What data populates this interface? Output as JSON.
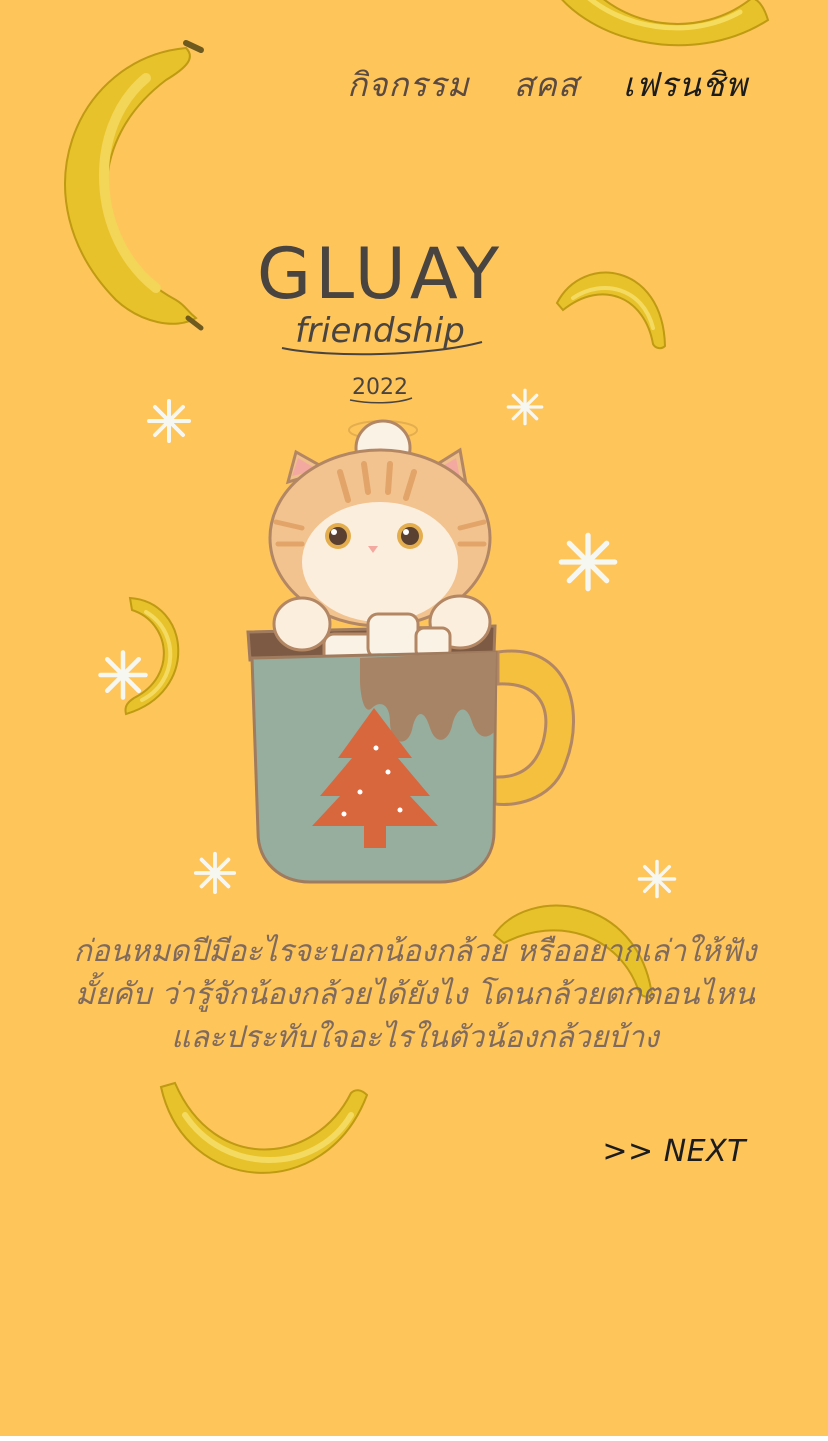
{
  "nav": {
    "items": [
      {
        "label": "กิจกรรม",
        "active": false
      },
      {
        "label": "สคส",
        "active": false
      },
      {
        "label": "เฟรนชิพ",
        "active": true
      }
    ]
  },
  "logo": {
    "title": "GLUAY",
    "subtitle": "friendship",
    "year": "2022"
  },
  "message": {
    "text": "ก่อนหมดปีมีอะไรจะบอกน้องกล้วย หรืออยากเล่าให้ฟังมั้ยคับ ว่ารู้จักน้องกล้วยได้ยังไง โดนกล้วยตกตอนไหน และประทับใจอะไรในตัวน้องกล้วยบ้าง"
  },
  "next": {
    "label": ">> NEXT"
  },
  "colors": {
    "background": "#FEC55B",
    "banana": "#E8C22A",
    "text": "#7F6A5E",
    "mug": "#97AE9F",
    "tree": "#D9673E"
  }
}
